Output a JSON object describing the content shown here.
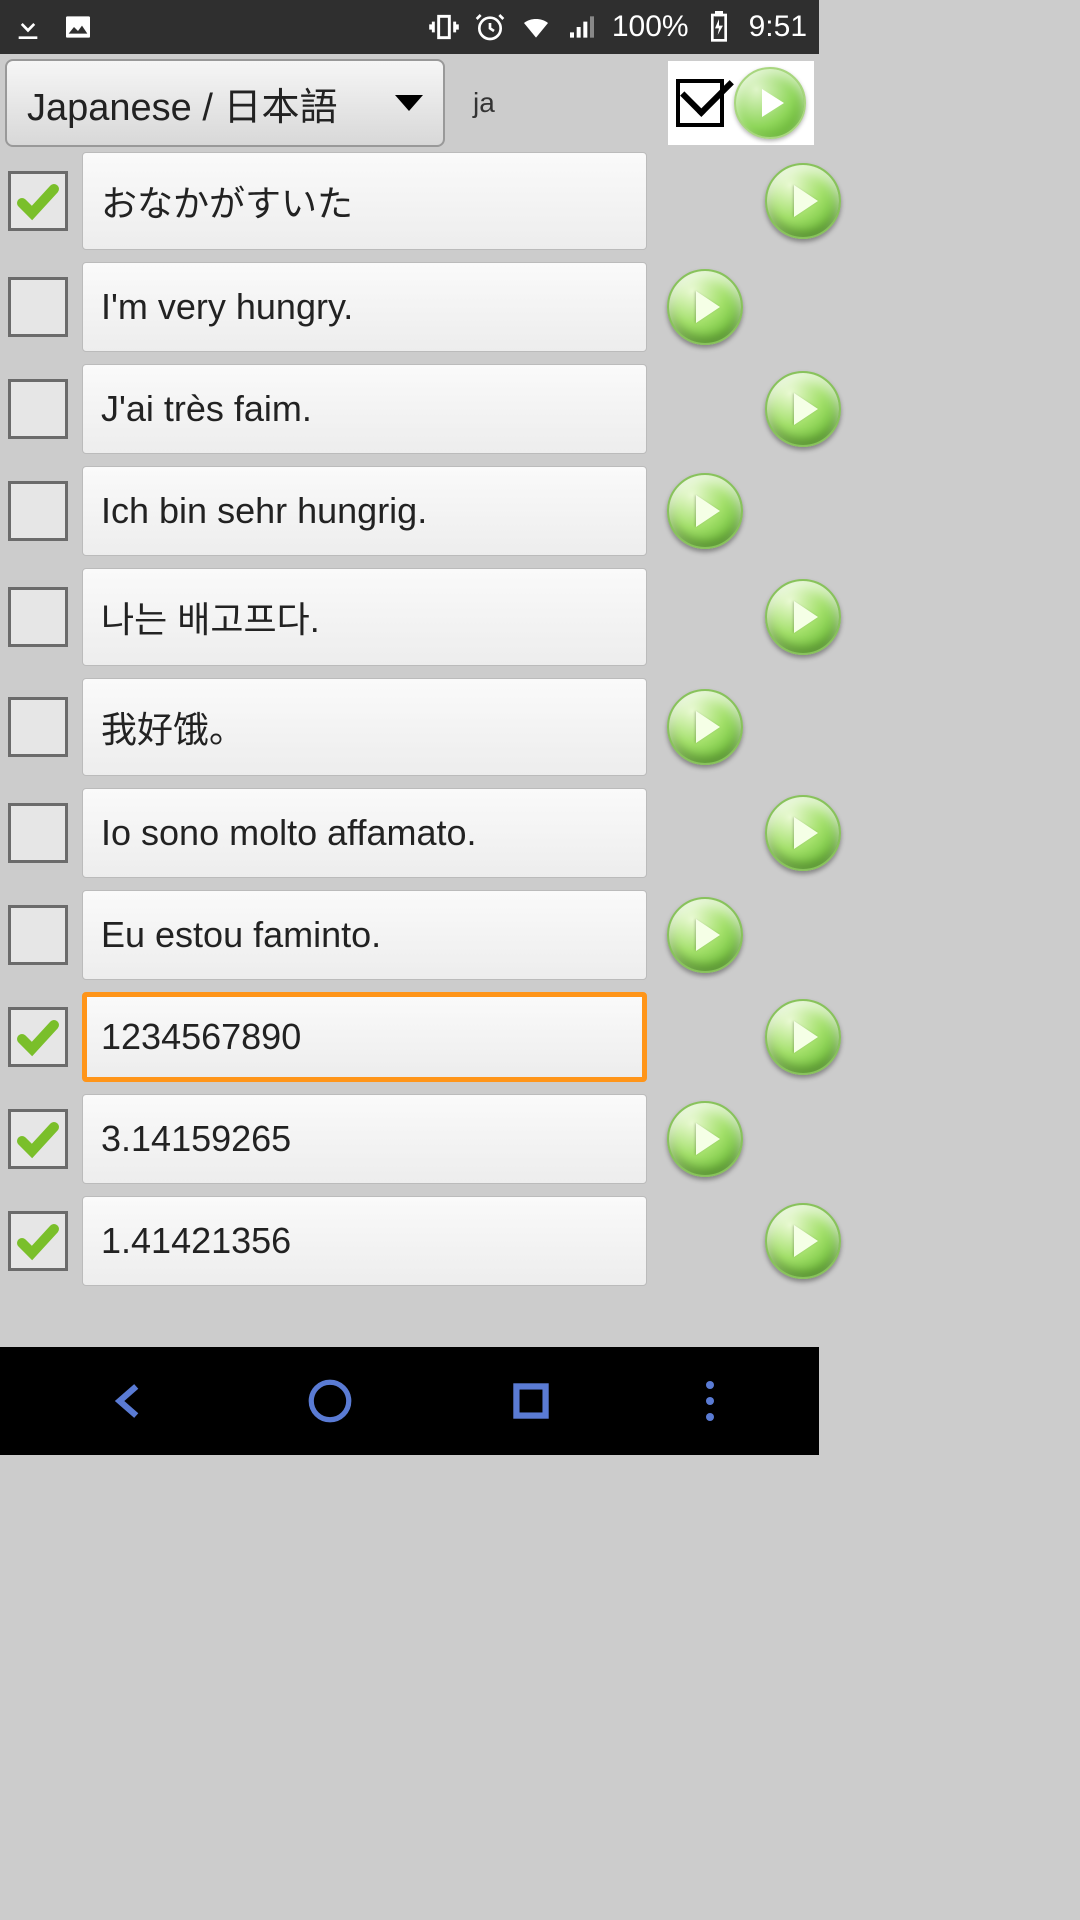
{
  "status": {
    "battery": "100%",
    "time": "9:51"
  },
  "header": {
    "dropdown_label": "Japanese / 日本語",
    "lang_code": "ja"
  },
  "rows": [
    {
      "checked": true,
      "text": "おなかがすいた",
      "play_pos": "right",
      "selected": false
    },
    {
      "checked": false,
      "text": "I'm very hungry.",
      "play_pos": "mid",
      "selected": false
    },
    {
      "checked": false,
      "text": "J'ai très faim.",
      "play_pos": "right",
      "selected": false
    },
    {
      "checked": false,
      "text": "Ich bin sehr hungrig.",
      "play_pos": "mid",
      "selected": false
    },
    {
      "checked": false,
      "text": "나는 배고프다.",
      "play_pos": "right",
      "selected": false
    },
    {
      "checked": false,
      "text": "我好饿。",
      "play_pos": "mid",
      "selected": false
    },
    {
      "checked": false,
      "text": "Io sono molto affamato.",
      "play_pos": "right",
      "selected": false
    },
    {
      "checked": false,
      "text": "Eu estou faminto.",
      "play_pos": "mid",
      "selected": false
    },
    {
      "checked": true,
      "text": "1234567890",
      "play_pos": "right",
      "selected": true
    },
    {
      "checked": true,
      "text": "3.14159265",
      "play_pos": "mid",
      "selected": false
    },
    {
      "checked": true,
      "text": "1.41421356",
      "play_pos": "right",
      "selected": false
    }
  ]
}
